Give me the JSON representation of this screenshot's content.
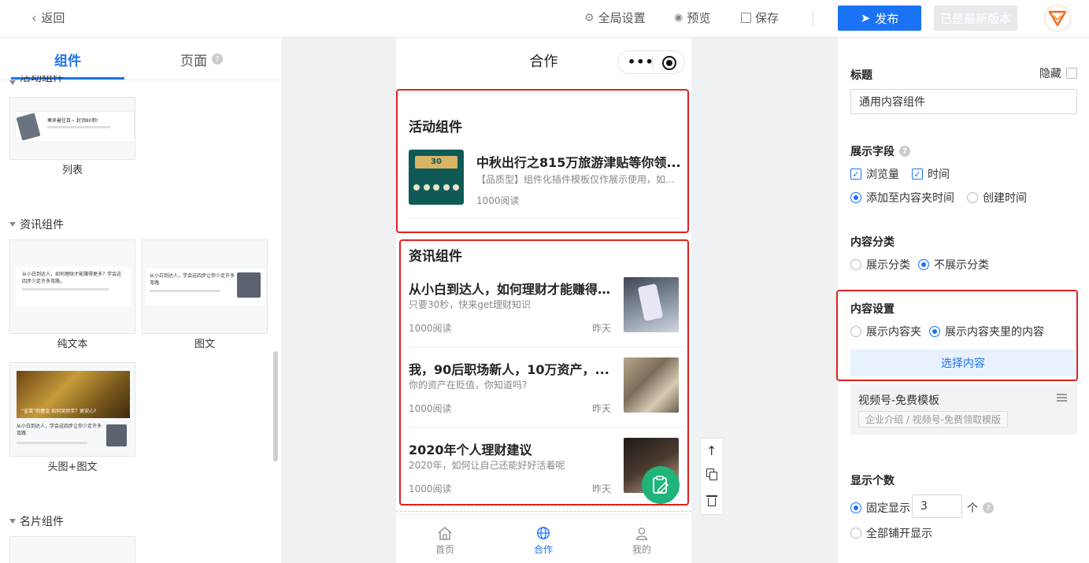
{
  "topbar": {
    "back": "返回",
    "global_settings": "全局设置",
    "preview": "预览",
    "save": "保存",
    "publish": "发布",
    "latest_version": "已是最新版本"
  },
  "left": {
    "tab_components": "组件",
    "tab_page": "页面",
    "activity_section": "活动组件",
    "activity_thumb_text": "寒来暑往目~ 封顶80积!",
    "item_list": "列表",
    "news_section": "资讯组件",
    "thumb_headline": "从小白到达人，如何理财才能赚得更多？学会这四步少走许多弯路。",
    "thumb_headline_short": "从小白到达人，学会这四步让你少走许多弯路",
    "thumb_banner_text": "“韭菜”的基金 如何突然手？更安心?",
    "item_plain_text": "纯文本",
    "item_image_text": "图文",
    "item_header_image_text": "头图+图文",
    "card_section": "名片组件"
  },
  "phone": {
    "title": "合作",
    "activity": {
      "heading": "活动组件",
      "item_title": "中秋出行之815万旅游津贴等你领...",
      "item_sub": "【品质型】组件化插件模板仅作展示使用，如...",
      "item_reads": "1000阅读",
      "poster_text": "30"
    },
    "news": {
      "heading": "资讯组件",
      "items": [
        {
          "title": "从小白到达人，如何理财才能赚得...",
          "sub": "只要30秒，快来get理财知识",
          "reads": "1000阅读",
          "time": "昨天"
        },
        {
          "title": "我，90后职场新人，10万资产，...",
          "sub": "你的资产在贬值，你知道吗?",
          "reads": "1000阅读",
          "time": "昨天"
        },
        {
          "title": "2020年个人理财建议",
          "sub": "2020年，如何让自己还能好好活着呢",
          "reads": "1000阅读",
          "time": "昨天"
        }
      ]
    },
    "tabbar": {
      "home": "首页",
      "coop": "合作",
      "mine": "我的"
    }
  },
  "right": {
    "title_label": "标题",
    "hide_label": "隐藏",
    "title_value": "通用内容组件",
    "fields_label": "展示字段",
    "field_views": "浏览量",
    "field_time": "时间",
    "time_added": "添加至内容夹时间",
    "time_created": "创建时间",
    "category_label": "内容分类",
    "show_category": "展示分类",
    "hide_category": "不展示分类",
    "content_settings_label": "内容设置",
    "show_folder": "展示内容夹",
    "show_folder_content": "展示内容夹里的内容",
    "select_content": "选择内容",
    "selected_title": "视频号-免费模板",
    "selected_path": "企业介绍 / 视频号-免费领取模版",
    "count_label": "显示个数",
    "fixed_show": "固定显示",
    "count_value": "3",
    "count_unit": "个",
    "show_all": "全部铺开显示"
  },
  "colors": {
    "accent": "#1a73f5",
    "highlight": "#e02020",
    "fab": "#1fb57a"
  }
}
